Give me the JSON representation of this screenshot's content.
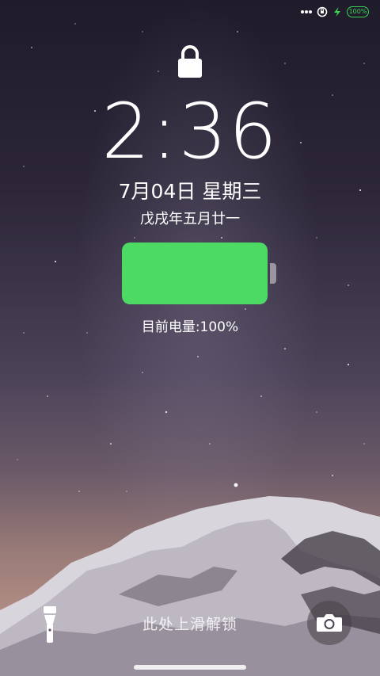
{
  "status_bar": {
    "battery_label": "100%",
    "icons": [
      "more-dots-icon",
      "location-lock-icon",
      "charging-bolt-icon",
      "battery-icon"
    ],
    "battery_color": "#39d353"
  },
  "lockscreen": {
    "lock_icon": "padlock-icon",
    "time": "2:36",
    "date": "7月04日 星期三",
    "lunar_date": "戊戌年五月廿一",
    "battery_level": 1.0,
    "battery_fill_color": "#4cd964",
    "battery_text": "目前电量:100%",
    "unlock_hint": "此处上滑解锁",
    "flashlight_icon": "flashlight-icon",
    "camera_icon": "camera-icon"
  }
}
